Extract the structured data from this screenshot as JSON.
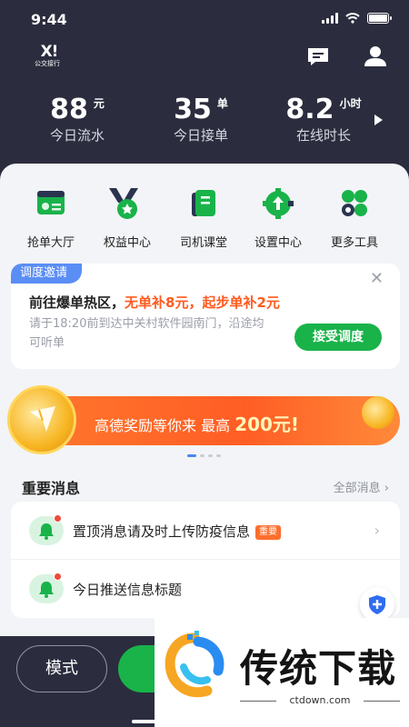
{
  "status_bar": {
    "time": "9:44"
  },
  "header": {
    "logo_mark": "X!",
    "logo_text": "公交接行",
    "icons": [
      "message-icon",
      "user-icon"
    ]
  },
  "stats": [
    {
      "value": "88",
      "unit": "元",
      "label": "今日流水"
    },
    {
      "value": "35",
      "unit": "单",
      "label": "今日接单"
    },
    {
      "value": "8.2",
      "unit": "小时",
      "label": "在线时长"
    }
  ],
  "quick_actions": [
    {
      "label": "抢单大厅",
      "icon": "order-hall-icon"
    },
    {
      "label": "权益中心",
      "icon": "medal-icon"
    },
    {
      "label": "司机课堂",
      "icon": "book-icon"
    },
    {
      "label": "设置中心",
      "icon": "gear-icon"
    },
    {
      "label": "更多工具",
      "icon": "more-tools-icon"
    }
  ],
  "dispatch": {
    "tag": "调度邀请",
    "title_prefix": "前往爆单热区，",
    "title_highlight": "无单补8元，起步单补2元",
    "description": "请于18:20前到达中关村软件园南门，沿途均可听单",
    "accept_label": "接受调度",
    "close": "✕"
  },
  "banner": {
    "text": "高德奖励等你来 最高",
    "amount": "200元!"
  },
  "messages": {
    "header": "重要消息",
    "all_label": "全部消息 ›",
    "items": [
      {
        "title": "置顶消息请及时上传防疫信息",
        "tag": "重要"
      },
      {
        "title": "今日推送信息标题"
      }
    ]
  },
  "bottom": {
    "mode_label": "模式"
  },
  "watermark": {
    "title": "传统下载",
    "url": "ctdown.com"
  },
  "colors": {
    "primary_green": "#19b34a",
    "accent_orange": "#ff5a1f",
    "dark_bg": "#2b2d3e",
    "blue_tag": "#5a8ef5"
  }
}
